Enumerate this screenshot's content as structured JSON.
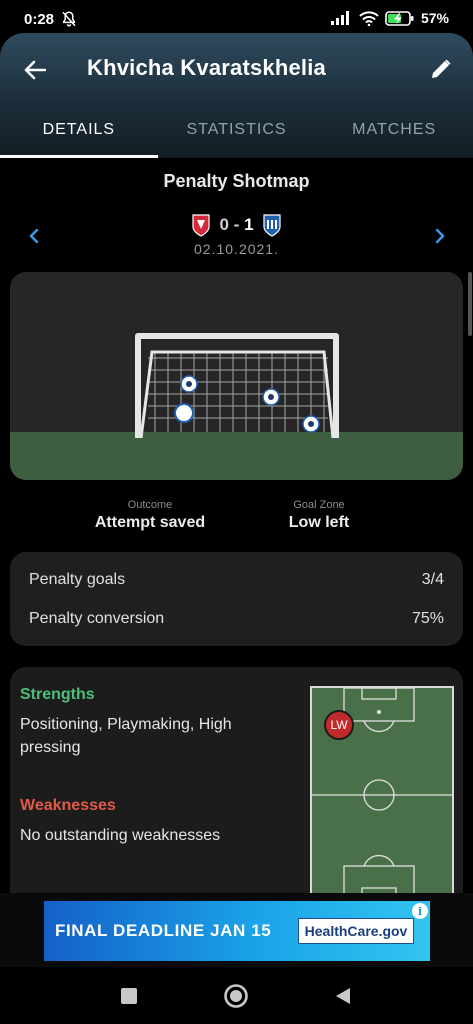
{
  "status_bar": {
    "time": "0:28",
    "battery_percent": "57%",
    "icons": [
      "bell-off-icon",
      "signal-icon",
      "wifi-icon",
      "battery-charging-icon"
    ]
  },
  "header": {
    "title": "Khvicha Kvaratskhelia",
    "back_icon": "back-arrow-icon",
    "edit_icon": "pencil-icon"
  },
  "tabs": [
    {
      "label": "DETAILS",
      "active": true
    },
    {
      "label": "STATISTICS",
      "active": false
    },
    {
      "label": "MATCHES",
      "active": false
    }
  ],
  "penalty": {
    "section_title": "Penalty Shotmap",
    "home_score": "0",
    "separator": "-",
    "away_score": "1",
    "date": "02.10.2021.",
    "outcome_label": "Outcome",
    "outcome_value": "Attempt saved",
    "goal_zone_label": "Goal Zone",
    "goal_zone_value": "Low left"
  },
  "penalty_stats": {
    "goals_label": "Penalty goals",
    "goals_value": "3/4",
    "conversion_label": "Penalty conversion",
    "conversion_value": "75%"
  },
  "profile": {
    "strengths_heading": "Strengths",
    "strengths_line1": "Positioning, Playmaking, High",
    "strengths_line2": "pressing",
    "weaknesses_heading": "Weaknesses",
    "weaknesses_text": "No outstanding weaknesses",
    "position_badge": "LW"
  },
  "ad": {
    "text": "FINAL DEADLINE JAN 15",
    "logo_text": "HealthCare.gov",
    "info_symbol": "i"
  },
  "colors": {
    "strength": "#4cc07a",
    "weakness": "#e05a4a",
    "accent_blue": "#3d9ae8",
    "badge_red": "#c22b2b"
  }
}
